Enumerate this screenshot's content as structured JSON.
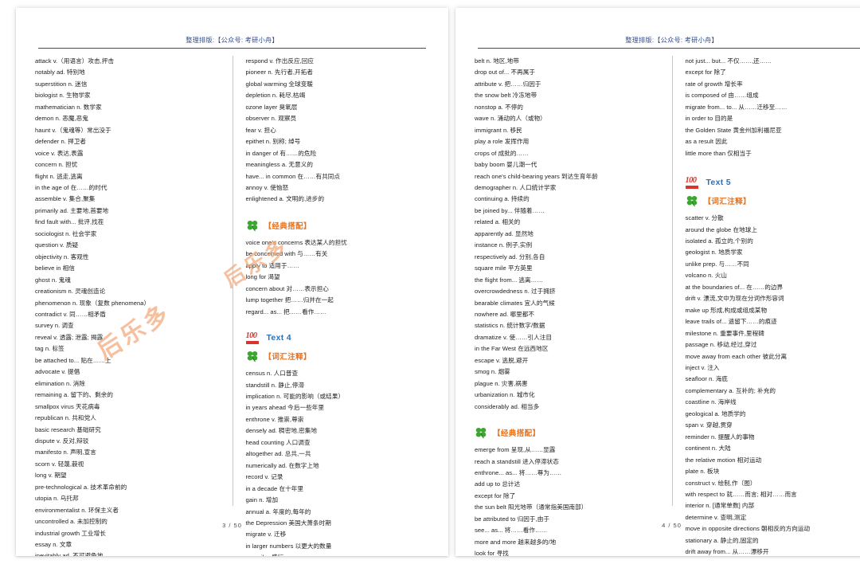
{
  "viewer": {
    "accent_blue": "#2e6fb7",
    "accent_orange": "#e8721c",
    "accent_red": "#d8342c",
    "clover_green": "#3aa72e",
    "header_blue": "#2e4b8f",
    "watermark_text": "后乐多"
  },
  "pages": [
    {
      "header": "整理排版:【公众号: 考研小舟】",
      "footer": "3 / 50",
      "columns": [
        {
          "blocks": [
            {
              "type": "entries",
              "items": [
                "attack  v.（用语言）攻击,抨击",
                "notably  ad. 特别地",
                "superstition  n. 迷信",
                "biologist  n. 生物学家",
                "mathematician  n. 数学家",
                "demon  n. 恶魔,恶鬼",
                "haunt  v.（鬼魂等）常出没于",
                "defender  n. 捍卫者",
                "voice  v. 表达,表露",
                "concern  n. 担忧",
                "flight  n. 逃走,逃离",
                "in the age of  在……的时代",
                "assemble  v. 集合,聚集",
                "primarily  ad. 主要地,首要地",
                "find fault with...  批评,找茬",
                "sociologist  n. 社会学家",
                "question  v. 质疑",
                "objectivity  n. 客观性",
                "believe in  相信",
                "ghost  n. 鬼魂",
                "creationism  n. 灵魂创造论",
                "phenomenon  n. 现象（复数 phenomena）",
                "contradict  v. 同……相矛盾",
                "survey  n. 调查",
                "reveal  v. 透露; 泄露; 揭露",
                "tag  n. 标签",
                "be attached to...  贴在……上",
                "advocate  v. 提倡",
                "elimination  n. 消除",
                "remaining  a. 留下的、剩余的",
                "smallpox virus  天花病毒",
                "republican  n. 共和党人",
                "basic research  基础研究",
                "dispute  v. 反对,辩驳",
                "manifesto  n. 声明,宣言",
                "scorn  v. 轻蔑,藐视",
                "long v. 期望",
                "pre-technological  a. 技术革命前的",
                "utopia  n. 乌托邦",
                "environmentalist  n. 环保主义者",
                "uncontrolled  a. 未加控制的",
                "industrial growth  工业增长",
                "essay  n. 文章",
                "inevitably  ad. 不可避免地"
              ]
            }
          ]
        },
        {
          "blocks": [
            {
              "type": "entries",
              "items": [
                "respond  v. 作出反应,回应",
                "pioneer  n. 先行者,开拓者",
                "global warming  全球变暖",
                "depletion  n. 耗尽,枯竭",
                "ozone layer  臭氧层",
                "observer  n. 观察员",
                "fear  v. 担心",
                "epithet  n. 别称; 绰号",
                "in danger of  有……的危险",
                "meaningless  a. 无意义的",
                "have... in common  在……有共同点",
                "annoy  v. 使恼怒",
                "enlightened  a. 文明的,进步的"
              ]
            },
            {
              "type": "spacer",
              "size": "md"
            },
            {
              "type": "section-head",
              "icon": "clover-icon",
              "label": "【经典搭配】"
            },
            {
              "type": "entries",
              "items": [
                "voice one's concerns  表达某人的担忧",
                "be concerned with  与……有关",
                "apply to  适用于……",
                "long for  渴望",
                "concern about  对……表示担心",
                "lump together  把……归并在一起",
                "regard... as...  把……看作……"
              ]
            },
            {
              "type": "spacer",
              "size": "sm"
            },
            {
              "type": "text-head",
              "icon": "hundred-points-icon",
              "label": "Text 4"
            },
            {
              "type": "section-head",
              "icon": "clover-icon",
              "label": "【词汇注释】"
            },
            {
              "type": "entries",
              "items": [
                "census  n. 人口普查",
                "standstill  n. 静止,停滞",
                "implication  n. 可能的影响（或结果）",
                "in years ahead  今后一些年里",
                "enthrone  v. 推崇,尊崇",
                "densely  ad. 稠密地,密集地",
                "head counting  人口调查",
                "altogether  ad. 总共,一共",
                "numerically  ad. 在数字上地",
                "record  v. 记录",
                "in a decade  在十年里",
                "gain  n. 增加",
                "annual  a. 年度的,每年的",
                "the Depression  美国大萧条时期",
                "migrate  v. 迁移",
                "in larger numbers  以更大的数量",
                "prevail  v. 盛行"
              ]
            }
          ]
        }
      ]
    },
    {
      "header": "整理排版:【公众号: 考研小舟】",
      "footer": "4 / 50",
      "columns": [
        {
          "blocks": [
            {
              "type": "entries",
              "items": [
                "belt  n. 地区,地带",
                "drop out of...  不再属于",
                "attribute  v. 把……归因于",
                "the snow belt  冷冻地带",
                "nonstop  a. 不停的",
                "wave  n. 涌动的人（或物）",
                "immigrant  n. 移民",
                "play a role  发挥作用",
                "crops of  成批的……",
                "baby boom  婴儿潮一代",
                "reach one's child-bearing years  到达生育年龄",
                "demographer  n. 人口统计学家",
                "continuing  a. 持续的",
                "be joined by...  伴随着……",
                "related  a. 相关的",
                "apparently  ad. 显然地",
                "instance  n. 例子,实例",
                "respectively  ad. 分别,各自",
                "square mile  平方英里",
                "the flight from...  逃离……",
                "overcrowdedness  n. 过于拥挤",
                "bearable climates  宜人的气候",
                "nowhere  ad. 哪里都不",
                "statistics  n. 统计数字/数据",
                "dramatize  v. 使……引人注目",
                "in the Far West  在远西地区",
                "escape  v. 逃脱,避开",
                "smog  n. 烟雾",
                "plague  n. 灾害,祸害",
                "urbanization  n. 城市化",
                "considerably  ad. 相当多"
              ]
            },
            {
              "type": "spacer",
              "size": "md"
            },
            {
              "type": "section-head",
              "icon": "clover-icon",
              "label": "【经典搭配】"
            },
            {
              "type": "entries",
              "items": [
                "emerge from  呈现,从……显露",
                "reach a standstill  进入停滞状态",
                "enthrone... as...  将……尊为……",
                "add up to  总计达",
                "except for  除了",
                "the sun belt  阳光地带（通常指美国南部）",
                "be attributed to  归因于,由于",
                "see... as...  将……看作……",
                "more and more  越来越多的/地",
                "look for  寻找"
              ]
            }
          ]
        },
        {
          "blocks": [
            {
              "type": "entries",
              "items": [
                "not just... but...  不仅……,还……",
                "except for  除了",
                "rate of growth  增长率",
                "is composed of  由……组成",
                "migrate from... to...  从……迁移至……",
                "in order to  目的是",
                "the Golden State  黄金州加利福尼亚",
                "as a result  因此",
                "little more than  仅相当于"
              ]
            },
            {
              "type": "spacer",
              "size": "md"
            },
            {
              "type": "text-head",
              "icon": "hundred-points-icon",
              "label": "Text 5"
            },
            {
              "type": "section-head",
              "icon": "clover-icon",
              "label": "【词汇注释】"
            },
            {
              "type": "entries",
              "items": [
                "scatter  v. 分散",
                "around the globe  在地球上",
                "isolated  a. 孤立的,个别的",
                "geologist  n. 地质学家",
                "unlike  prep. 与……不同",
                "volcano  n. 火山",
                "at the boundaries of...  在……的边界",
                "drift  v. 漂流,文中为现在分词作形容词",
                "make up  形成,构成或组成某物",
                "leave trails of...  遗留下……的痕迹",
                "milestone  n. 重要事件,里程碑",
                "passage  n. 移动,经过,穿过",
                "move away from each other  彼此分离",
                "inject  v. 注入",
                "seafloor  n. 海底",
                "complementary  a. 互补的; 补充的",
                "coastline  n. 海岸线",
                "geological  a. 地质学的",
                "span  v. 穿越,贯穿",
                "reminder  n. 提醒人的事物",
                "continent  n. 大陆",
                "the relative motion  相对运动",
                "plate  n. 板块",
                "construct  v. 绘制,作（图）",
                "with respect to  就……而言; 相对……而言",
                "interior  n. [通常单数] 内部",
                "determine  v. 查明,测定",
                "move in opposite directions  朝相反的方向运动",
                "stationary  a. 静止的,固定的",
                "drift away from...  从……漂移开"
              ]
            }
          ]
        }
      ]
    }
  ]
}
